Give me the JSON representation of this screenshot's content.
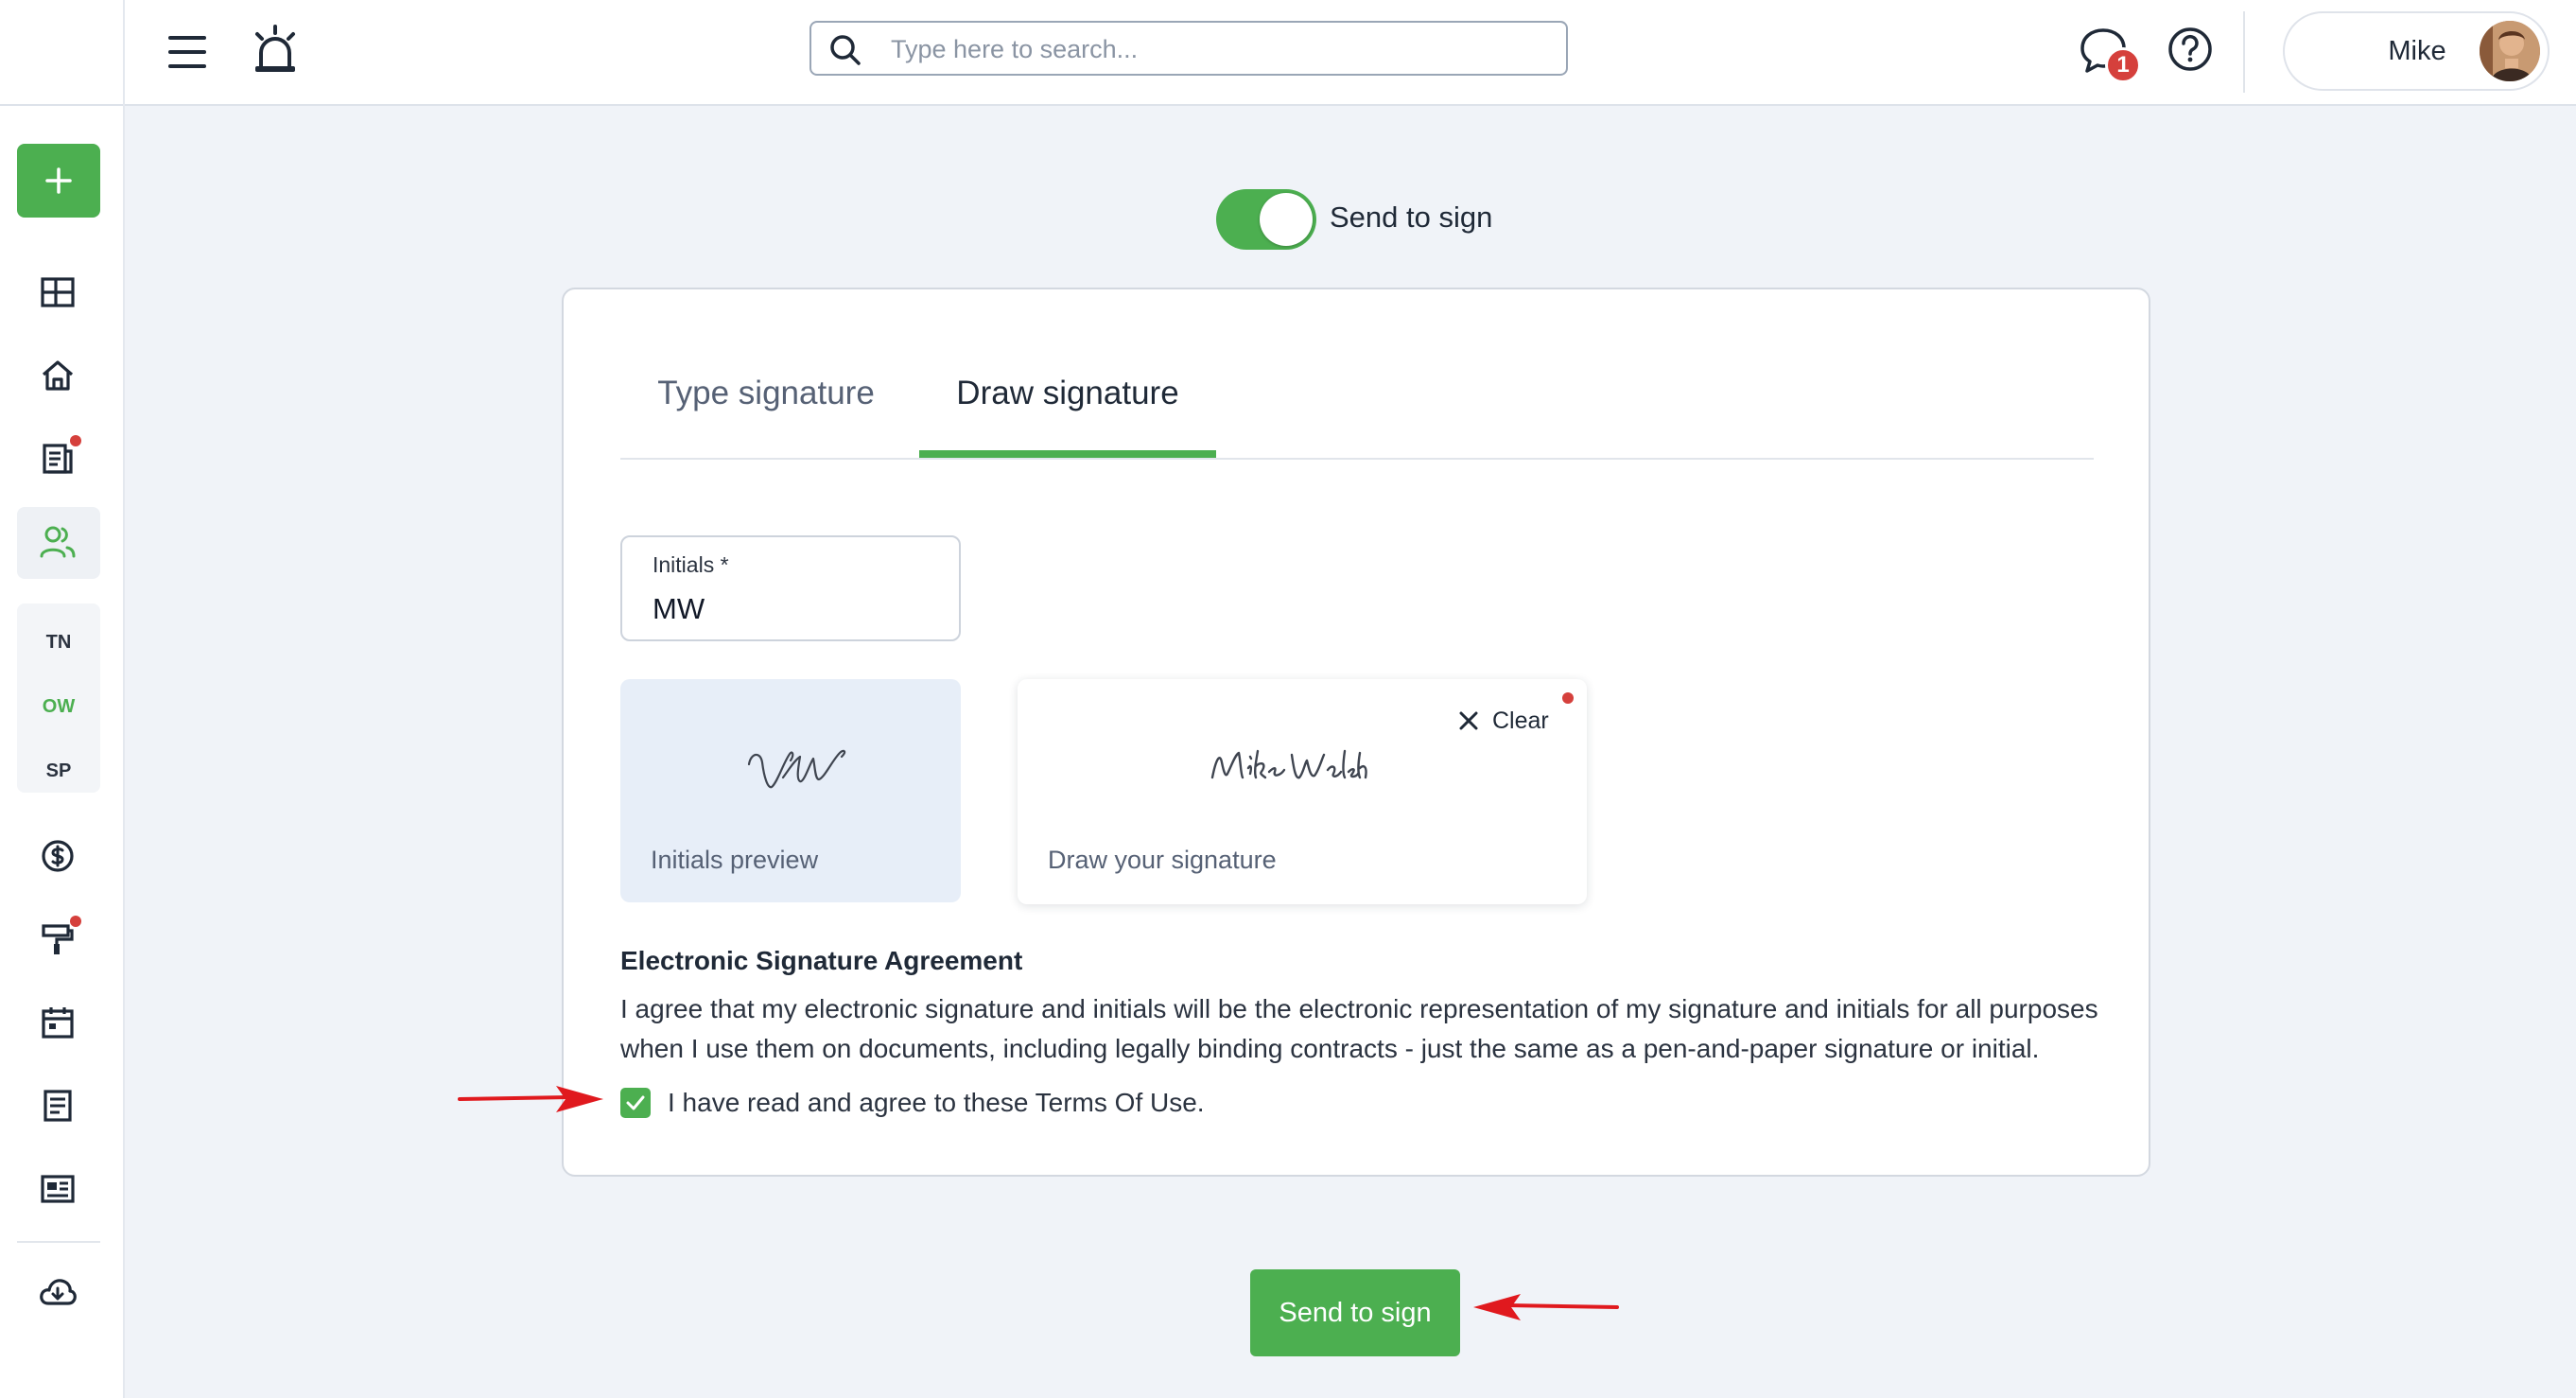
{
  "header": {
    "search": {
      "placeholder": "Type here to search..."
    },
    "notifications_count": "1",
    "user": {
      "name": "Mike"
    }
  },
  "sidebar": {
    "subitems": [
      "TN",
      "OW",
      "SP"
    ],
    "icons": [
      "add-icon",
      "dashboard-icon",
      "home-icon",
      "documents-icon",
      "contacts-icon",
      "dollar-icon",
      "paint-roller-icon",
      "calendar-icon",
      "notes-icon",
      "newspaper-icon",
      "cloud-download-icon"
    ]
  },
  "main": {
    "toggle": {
      "label": "Send to sign",
      "on": true
    },
    "tabs": [
      {
        "label": "Type signature",
        "active": false
      },
      {
        "label": "Draw signature",
        "active": true
      }
    ],
    "initials_field": {
      "label": "Initials *",
      "value": "MW"
    },
    "initials_preview": {
      "caption": "Initials preview"
    },
    "draw": {
      "caption": "Draw your signature",
      "clear_label": "Clear"
    },
    "agreement": {
      "title": "Electronic Signature Agreement",
      "text": "I agree that my electronic signature and initials will be the electronic representation of my signature and initials for all purposes when I use them on documents, including legally binding contracts - just the same as a pen-and-paper signature or initial.",
      "checkbox_label": "I have read and agree to these Terms Of Use.",
      "checked": true
    },
    "submit_label": "Send to sign"
  },
  "colors": {
    "accent": "#4caf50",
    "badge": "#d5403c",
    "annotation_arrow": "#e0191e",
    "background": "#f0f3f8"
  }
}
